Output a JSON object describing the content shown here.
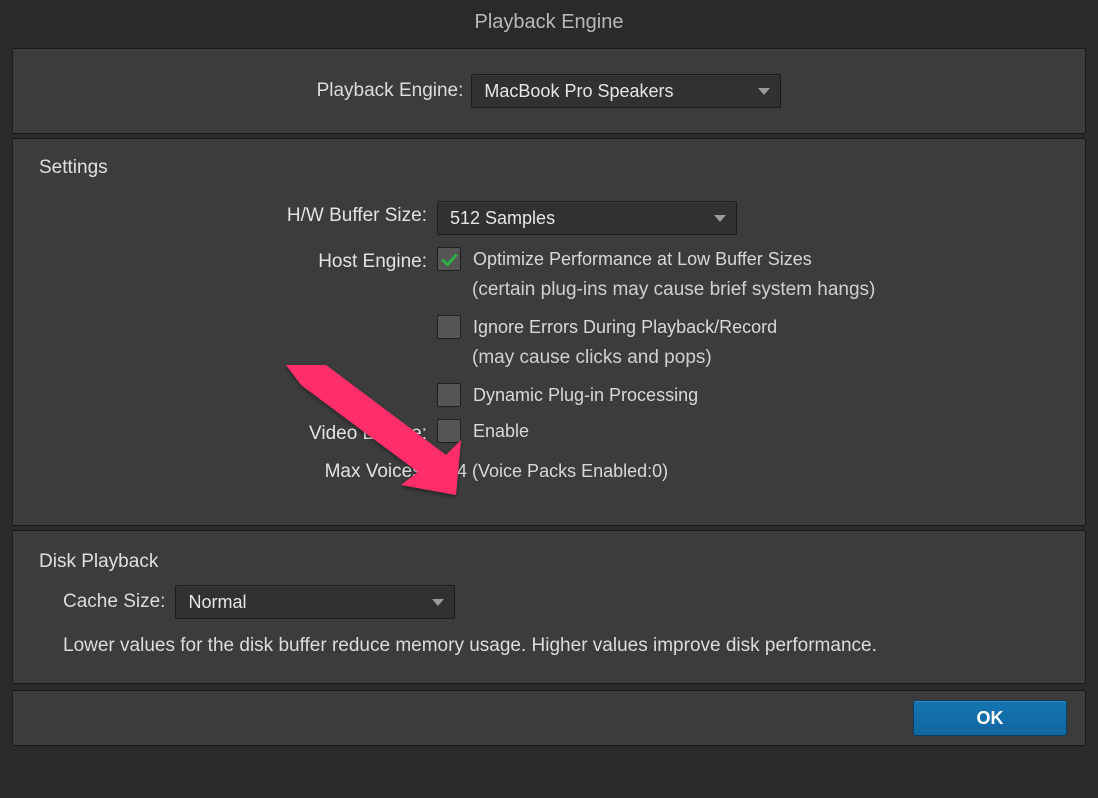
{
  "title": "Playback Engine",
  "playback": {
    "label": "Playback Engine:",
    "value": "MacBook Pro Speakers"
  },
  "settings": {
    "title": "Settings",
    "buffer": {
      "label": "H/W Buffer Size:",
      "value": "512 Samples"
    },
    "host": {
      "label": "Host Engine:",
      "opt_optimize": "Optimize Performance at Low Buffer Sizes",
      "opt_optimize_hint": "(certain plug-ins may cause brief system hangs)",
      "opt_ignore": "Ignore Errors During Playback/Record",
      "opt_ignore_hint": "(may cause clicks and pops)",
      "opt_dynamic": "Dynamic Plug-in Processing"
    },
    "video": {
      "label": "Video Engine:",
      "enable": "Enable"
    },
    "voices": {
      "label": "Max Voices:",
      "value": "384 (Voice Packs Enabled:0)"
    }
  },
  "disk": {
    "title": "Disk Playback",
    "cache_label": "Cache Size:",
    "cache_value": "Normal",
    "hint": "Lower values for the disk buffer reduce memory usage.  Higher values improve disk performance."
  },
  "buttons": {
    "ok": "OK"
  }
}
